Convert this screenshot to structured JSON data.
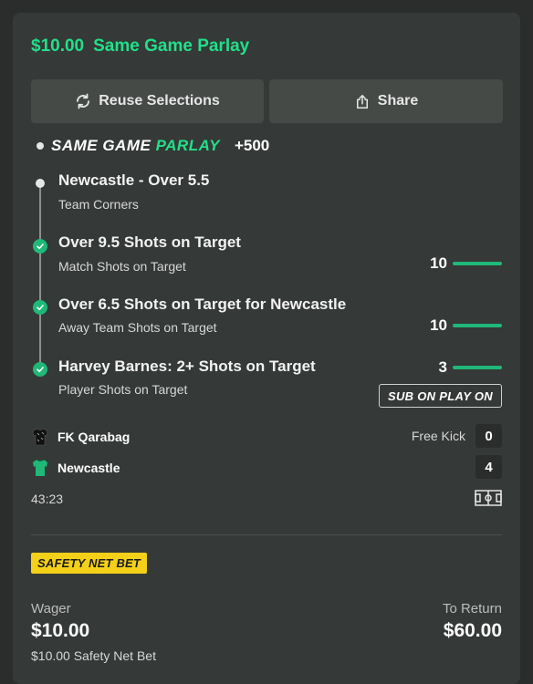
{
  "header": {
    "stake": "$10.00",
    "title": "Same Game Parlay"
  },
  "actions": {
    "reuse_label": "Reuse Selections",
    "share_label": "Share"
  },
  "parlay": {
    "title_a": "SAME GAME",
    "title_b": "PARLAY",
    "odds": "+500"
  },
  "legs": [
    {
      "title": "Newcastle - Over 5.5",
      "subtitle": "Team Corners",
      "status": "pending"
    },
    {
      "title": "Over 9.5 Shots on Target",
      "subtitle": "Match Shots on Target",
      "status": "won",
      "current": "10"
    },
    {
      "title": "Over 6.5 Shots on Target for Newcastle",
      "subtitle": "Away Team Shots on Target",
      "status": "won",
      "current": "10"
    },
    {
      "title": "Harvey Barnes: 2+ Shots on Target",
      "subtitle": "Player Shots on Target",
      "status": "won",
      "current": "3",
      "badge": "SUB ON PLAY ON"
    }
  ],
  "match": {
    "home": {
      "name": "FK Qarabag",
      "score": "0",
      "kit_color": "#1a1a1a"
    },
    "away": {
      "name": "Newcastle",
      "score": "4",
      "kit_color": "#1fb878"
    },
    "event": "Free Kick",
    "clock": "43:23"
  },
  "safety_badge": "SAFETY NET BET",
  "wager": {
    "label": "Wager",
    "amount": "$10.00",
    "note": "$10.00 Safety Net Bet"
  },
  "returns": {
    "label": "To Return",
    "amount": "$60.00"
  },
  "colors": {
    "accent": "#21e08a",
    "success": "#1fb878",
    "safety": "#f4d019"
  }
}
